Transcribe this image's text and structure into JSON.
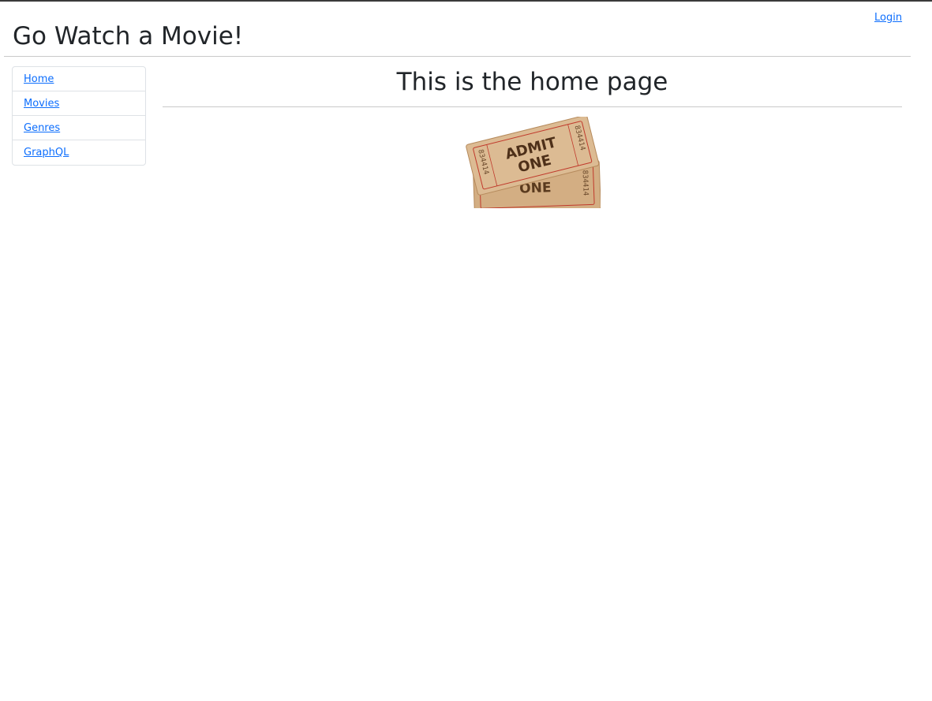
{
  "header": {
    "title": "Go Watch a Movie!",
    "login_label": "Login"
  },
  "sidebar": {
    "items": [
      {
        "label": "Home"
      },
      {
        "label": "Movies"
      },
      {
        "label": "Genres"
      },
      {
        "label": "GraphQL"
      }
    ]
  },
  "main": {
    "heading": "This is the home page",
    "image": {
      "alt": "Admit one movie tickets",
      "ticket_front_text": [
        "ADMIT",
        "ONE"
      ],
      "ticket_back_text": "ONE",
      "serial_number": "834414"
    }
  },
  "colors": {
    "link": "#0d6efd",
    "text": "#212529",
    "ticket": "#d8b48a",
    "ticket_ink": "#5a3a1e",
    "ticket_border": "#c0392b"
  }
}
